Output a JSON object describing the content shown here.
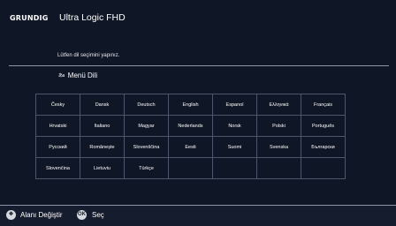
{
  "header": {
    "brand": "GRUNDIG",
    "model": "Ultra Logic FHD"
  },
  "prompt": "Lütfen dil seçimini yapınız.",
  "section": {
    "icon": "language-icon",
    "title": "Menü Dili"
  },
  "languages": [
    [
      "Česky",
      "Dansk",
      "Deutsch",
      "English",
      "Espanol",
      "Ελληνικά",
      "Français"
    ],
    [
      "Hrvatski",
      "Italiano",
      "Magyar",
      "Nederlands",
      "Norsk",
      "Polski",
      "Português"
    ],
    [
      "Русский",
      "Românește",
      "Slovenščina",
      "Eesti",
      "Suomi",
      "Svenska",
      "Български"
    ],
    [
      "Slovenčina",
      "Lietuviu",
      "Türkçe",
      "",
      "",
      "",
      ""
    ]
  ],
  "footer": {
    "move_icon": "dpad-icon",
    "move_label": "Alanı Değiştir",
    "ok_icon": "OK",
    "ok_label": "Seç"
  }
}
